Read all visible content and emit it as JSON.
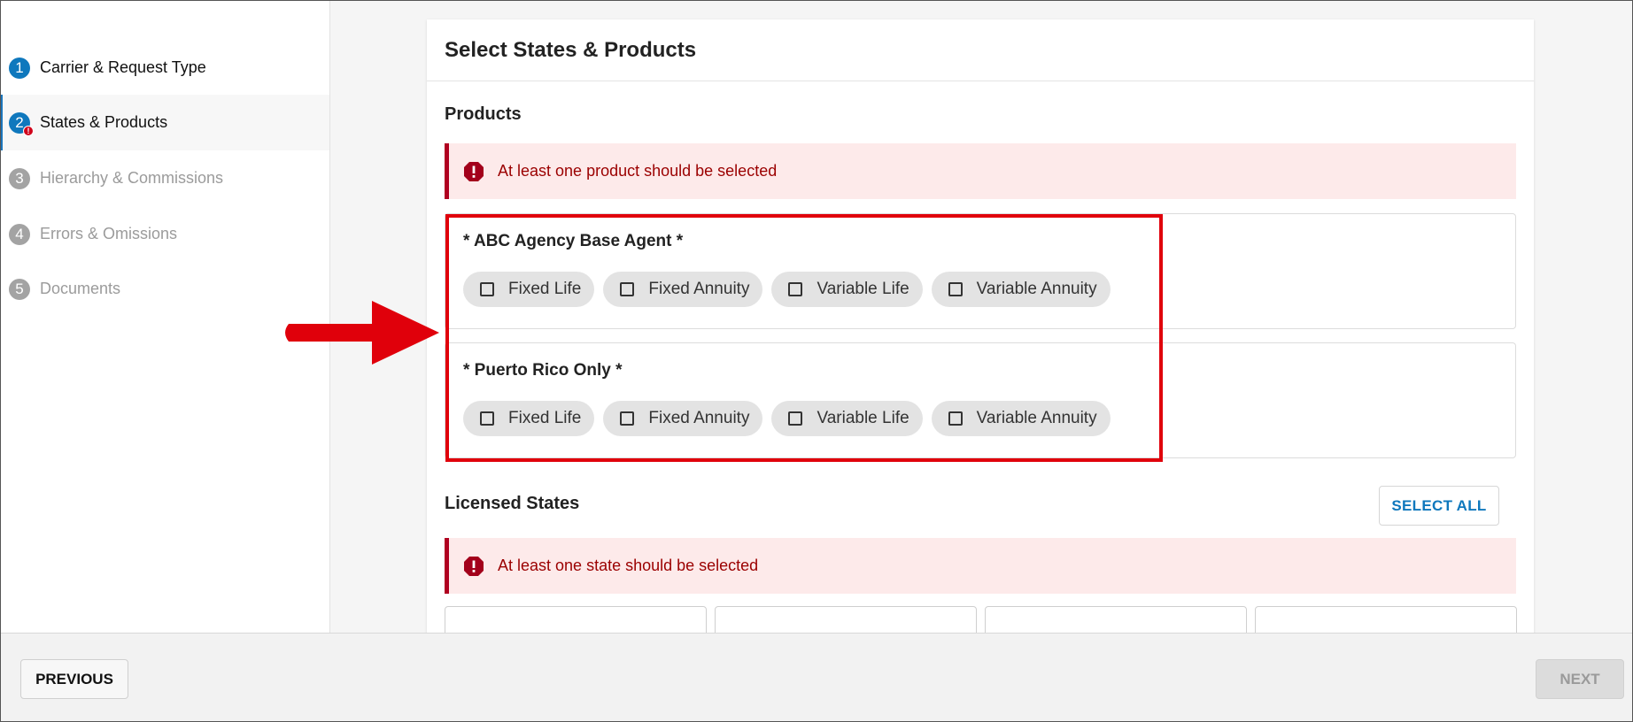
{
  "sidebar": {
    "steps": [
      {
        "number": "1",
        "label": "Carrier & Request Type"
      },
      {
        "number": "2",
        "label": "States & Products",
        "error_badge": "!"
      },
      {
        "number": "3",
        "label": "Hierarchy & Commissions"
      },
      {
        "number": "4",
        "label": "Errors & Omissions"
      },
      {
        "number": "5",
        "label": "Documents"
      }
    ]
  },
  "card": {
    "title": "Select States & Products"
  },
  "products": {
    "heading": "Products",
    "alert": "At least one product should be selected",
    "groups": [
      {
        "title": "* ABC Agency Base Agent *",
        "options": [
          "Fixed Life",
          "Fixed Annuity",
          "Variable Life",
          "Variable Annuity"
        ]
      },
      {
        "title": "* Puerto Rico Only *",
        "options": [
          "Fixed Life",
          "Fixed Annuity",
          "Variable Life",
          "Variable Annuity"
        ]
      }
    ]
  },
  "licensed_states": {
    "heading": "Licensed States",
    "select_all_label": "SELECT ALL",
    "alert": "At least one state should be selected"
  },
  "footer": {
    "previous_label": "PREVIOUS",
    "next_label": "NEXT"
  },
  "colors": {
    "accent": "#0f78bd",
    "error": "#b00020",
    "annotation": "#e0000b"
  }
}
